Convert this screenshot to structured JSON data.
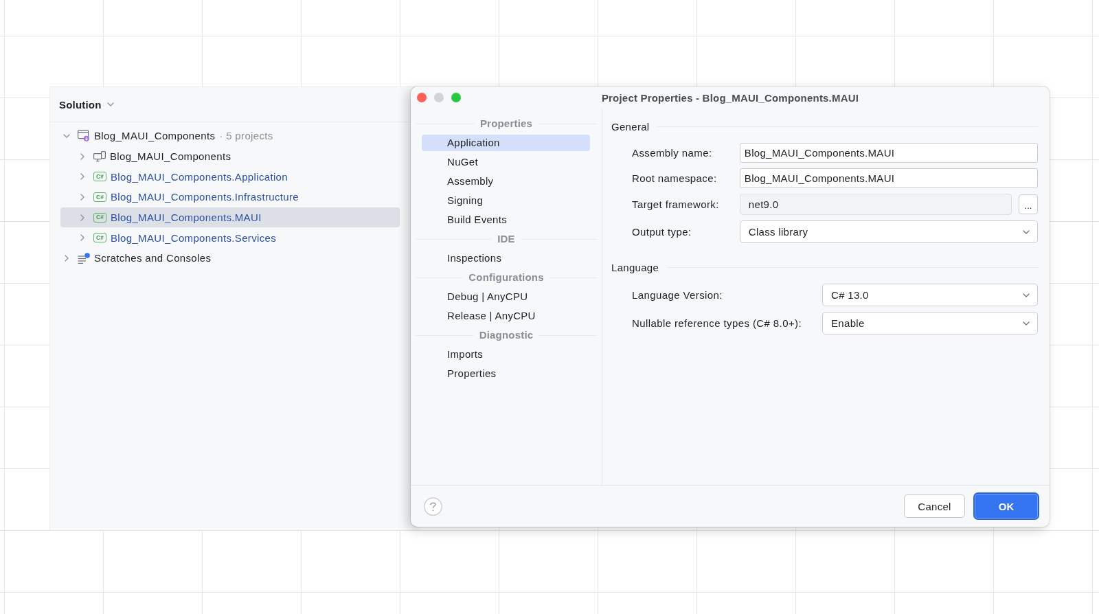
{
  "window_buttons": [
    {
      "kind": "close",
      "disabled": false
    },
    {
      "kind": "minimize",
      "disabled": true
    },
    {
      "kind": "zoom",
      "disabled": false
    }
  ],
  "solution_panel": {
    "title": "Solution",
    "tree": [
      {
        "kind": "solution",
        "label": "Blog_MAUI_Components",
        "detail": "· 5 projects",
        "color": "#1e1f22",
        "expanded": true,
        "selected": false,
        "children": [
          {
            "kind": "app",
            "label": "Blog_MAUI_Components",
            "color": "#1e1f22",
            "expanded": false,
            "selected": false
          },
          {
            "kind": "library",
            "badge": "C#",
            "label": "Blog_MAUI_Components.Application",
            "color": "#2a4fa3",
            "expanded": false,
            "selected": false
          },
          {
            "kind": "library",
            "badge": "C#",
            "label": "Blog_MAUI_Components.Infrastructure",
            "color": "#2a4fa3",
            "expanded": false,
            "selected": false
          },
          {
            "kind": "library",
            "badge": "C#",
            "label": "Blog_MAUI_Components.MAUI",
            "color": "#2a4fa3",
            "expanded": false,
            "selected": true
          },
          {
            "kind": "library",
            "badge": "C#",
            "label": "Blog_MAUI_Components.Services",
            "color": "#2a4fa3",
            "expanded": false,
            "selected": false
          }
        ]
      },
      {
        "kind": "scratches",
        "label": "Scratches and Consoles",
        "color": "#1e1f22",
        "expanded": false,
        "selected": false
      }
    ]
  },
  "dialog": {
    "title": "Project Properties - Blog_MAUI_Components.MAUI",
    "nav": [
      {
        "header": "Properties",
        "items": [
          {
            "label": "Application",
            "selected": true
          },
          {
            "label": "NuGet",
            "selected": false
          },
          {
            "label": "Assembly",
            "selected": false
          },
          {
            "label": "Signing",
            "selected": false
          },
          {
            "label": "Build Events",
            "selected": false
          }
        ]
      },
      {
        "header": "IDE",
        "items": [
          {
            "label": "Inspections",
            "selected": false
          }
        ]
      },
      {
        "header": "Configurations",
        "items": [
          {
            "label": "Debug | AnyCPU",
            "selected": false
          },
          {
            "label": "Release | AnyCPU",
            "selected": false
          }
        ]
      },
      {
        "header": "Diagnostic",
        "items": [
          {
            "label": "Imports",
            "selected": false
          },
          {
            "label": "Properties",
            "selected": false
          }
        ]
      }
    ],
    "sections": [
      {
        "title": "General",
        "fields": [
          {
            "kind": "text",
            "label": "Assembly name:",
            "value": "Blog_MAUI_Components.MAUI"
          },
          {
            "kind": "text",
            "label": "Root namespace:",
            "value": "Blog_MAUI_Components.MAUI"
          },
          {
            "kind": "browse",
            "label": "Target framework:",
            "value": "net9.0",
            "button": "..."
          },
          {
            "kind": "select",
            "label": "Output type:",
            "value": "Class library"
          }
        ]
      },
      {
        "title": "Language",
        "fields": [
          {
            "kind": "select",
            "label": "Language Version:",
            "value": "C# 13.0"
          },
          {
            "kind": "select",
            "label": "Nullable reference types (C# 8.0+):",
            "value": "Enable"
          }
        ]
      }
    ],
    "buttons": [
      {
        "kind": "secondary",
        "label": "Cancel"
      },
      {
        "kind": "primary",
        "label": "OK"
      }
    ]
  }
}
